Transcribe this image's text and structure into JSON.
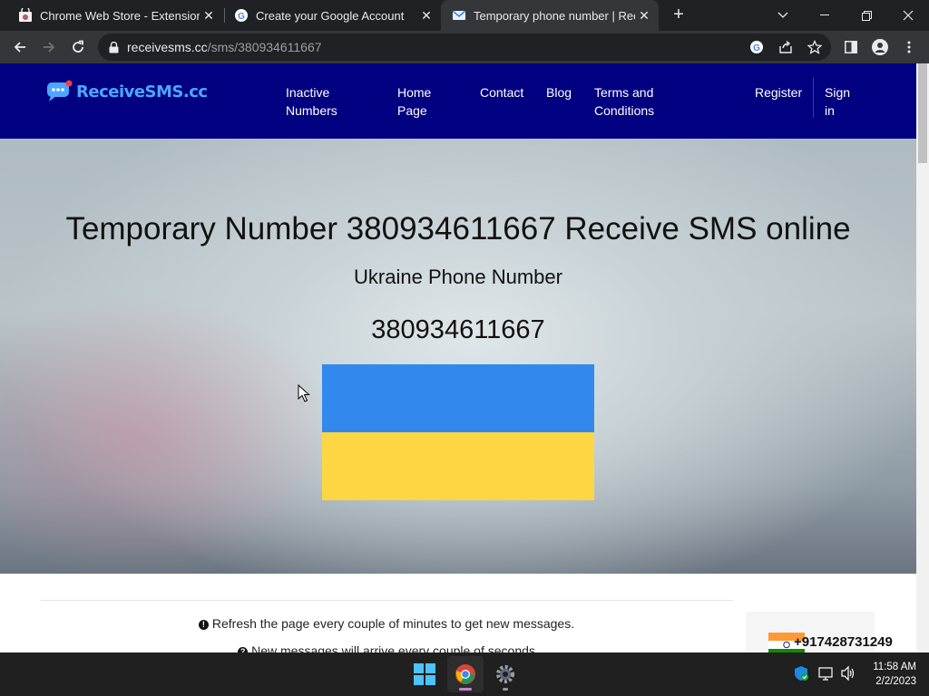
{
  "browser": {
    "tabs": [
      {
        "title": "Chrome Web Store - Extensions",
        "icon": "chrome-web-store-icon"
      },
      {
        "title": "Create your Google Account",
        "icon": "google-icon"
      },
      {
        "title": "Temporary phone number | Rece",
        "icon": "receivesms-icon",
        "active": true
      }
    ],
    "new_tab_label": "+",
    "url_domain": "receivesms.cc",
    "url_path": "/sms/380934611667"
  },
  "site": {
    "logo_text": "ReceiveSMS.cc",
    "nav": [
      {
        "line1": "Inactive",
        "line2": "Numbers"
      },
      {
        "line1": "Home",
        "line2": "Page"
      },
      {
        "line1": "Contact",
        "line2": ""
      },
      {
        "line1": "Blog",
        "line2": ""
      },
      {
        "line1": "Terms and",
        "line2": "Conditions"
      },
      {
        "line1": "Register",
        "line2": ""
      },
      {
        "line1": "Sign",
        "line2": "in"
      }
    ],
    "brand_color": "#000080"
  },
  "hero": {
    "title": "Temporary Number 380934611667 Receive SMS online",
    "subtitle": "Ukraine Phone Number",
    "number": "380934611667",
    "flag_colors": {
      "top": "#3388ee",
      "bottom": "#fdd743"
    }
  },
  "info": {
    "line1": "Refresh the page every couple of minutes to get new messages.",
    "line2": "New messages will arrive every couple of seconds"
  },
  "sidebar": {
    "phone": "+917428731249"
  },
  "taskbar": {
    "time": "11:58 AM",
    "date": "2/2/2023"
  }
}
